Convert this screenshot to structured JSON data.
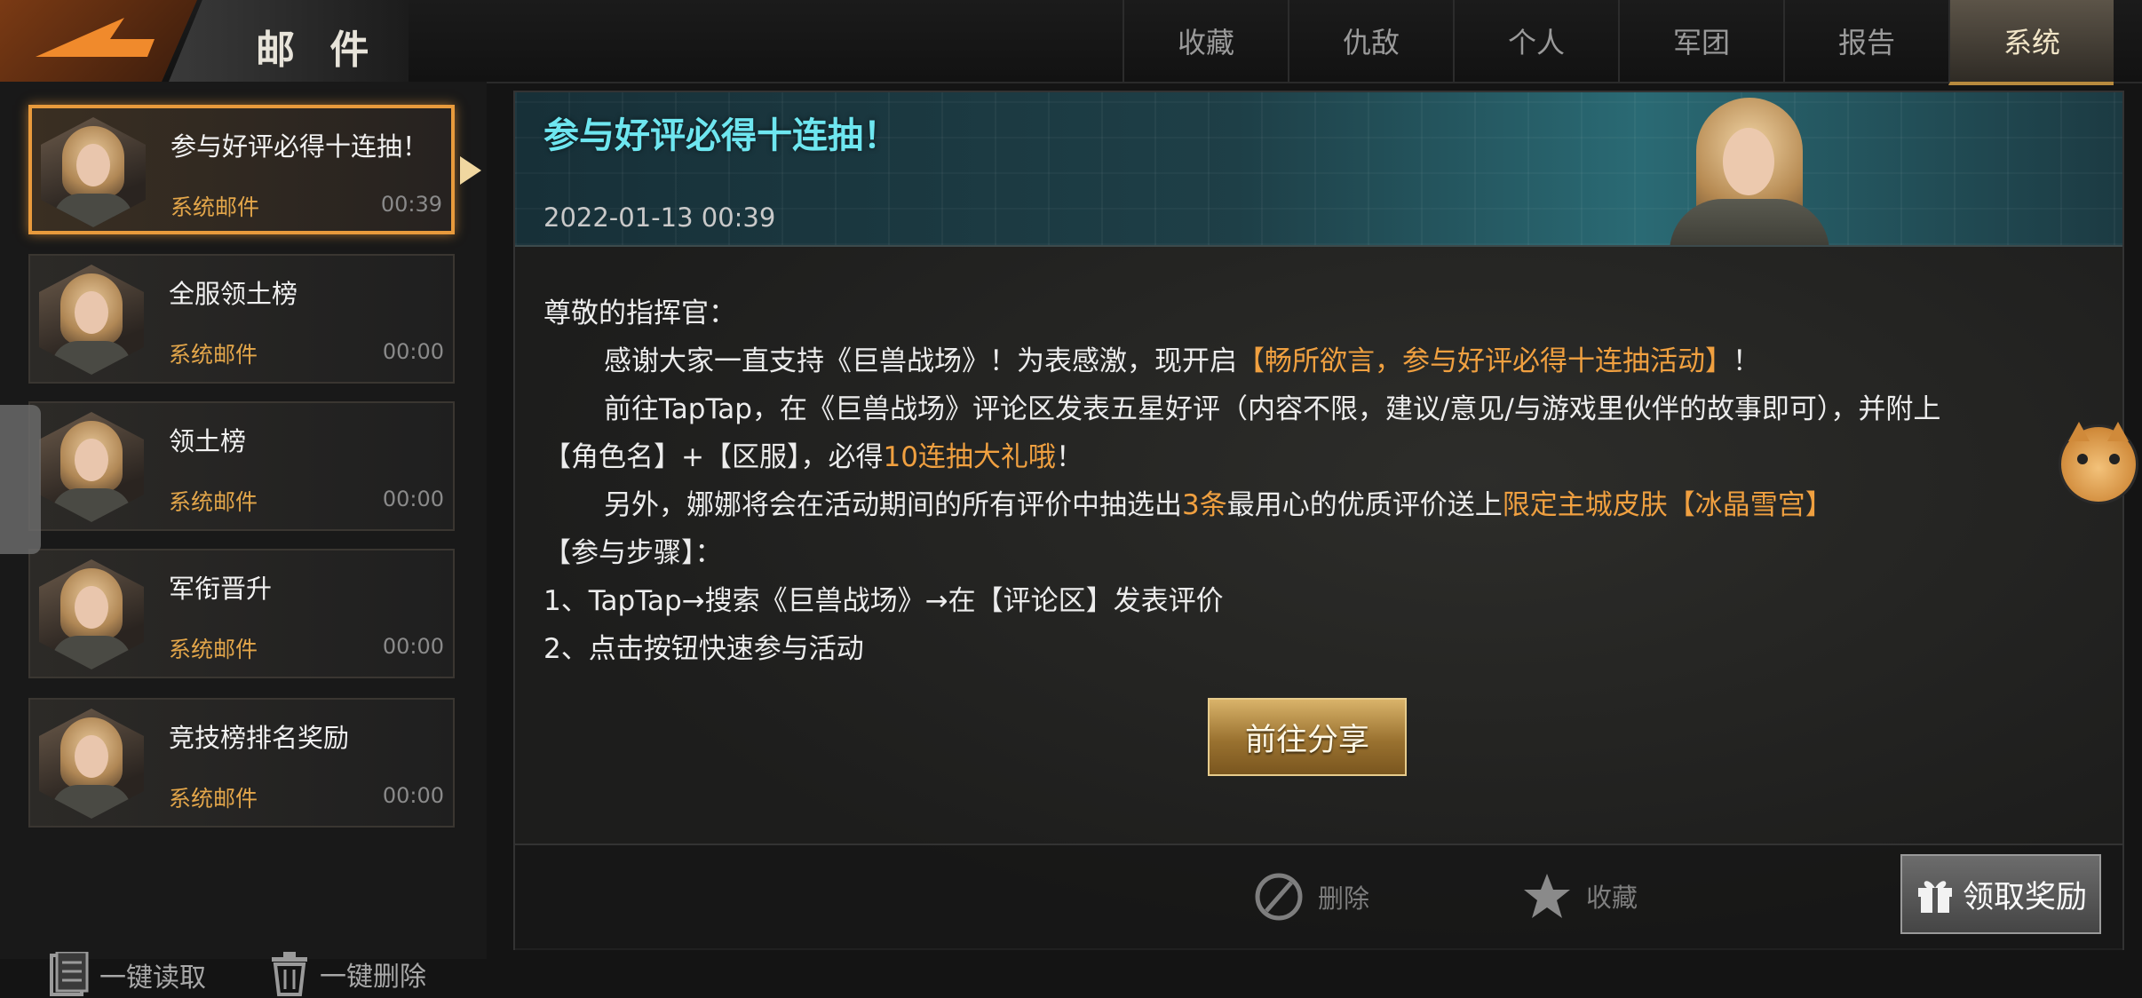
{
  "header": {
    "title": "邮 件",
    "tabs": [
      {
        "label": "收藏",
        "active": false
      },
      {
        "label": "仇敌",
        "active": false
      },
      {
        "label": "个人",
        "active": false
      },
      {
        "label": "军团",
        "active": false
      },
      {
        "label": "报告",
        "active": false
      },
      {
        "label": "系统",
        "active": true
      }
    ]
  },
  "mail_list": [
    {
      "title": "参与好评必得十连抽！",
      "sender": "系统邮件",
      "time": "00:39",
      "selected": true
    },
    {
      "title": "全服领土榜",
      "sender": "系统邮件",
      "time": "00:00",
      "selected": false
    },
    {
      "title": "领土榜",
      "sender": "系统邮件",
      "time": "00:00",
      "selected": false
    },
    {
      "title": "军衔晋升",
      "sender": "系统邮件",
      "time": "00:00",
      "selected": false
    },
    {
      "title": "竞技榜排名奖励",
      "sender": "系统邮件",
      "time": "00:00",
      "selected": false
    }
  ],
  "list_actions": {
    "read_all": "一键读取",
    "delete_all": "一键删除"
  },
  "mail": {
    "title": "参与好评必得十连抽！",
    "date": "2022-01-13  00:39",
    "greeting": "尊敬的指挥官：",
    "p1_a": "感谢大家一直支持《巨兽战场》！为表感激，现开启",
    "p1_hl": "【畅所欲言，参与好评必得十连抽活动】",
    "p1_b": "！",
    "p2_a": "前往TapTap，在《巨兽战场》评论区发表五星好评（内容不限，建议/意见/与游戏里伙伴的故事即可），并附上",
    "p2_b": "【角色名】+【区服】，必得",
    "p2_hl": "10连抽大礼哦",
    "p2_c": "！",
    "p3_a": "另外，娜娜将会在活动期间的所有评价中抽选出",
    "p3_hl1": "3条",
    "p3_b": "最用心的优质评价送上",
    "p3_hl2": "限定主城皮肤【冰晶雪宫】",
    "steps_title": "【参与步骤】：",
    "step1": "1、TapTap→搜索《巨兽战场》→在【评论区】发表评价",
    "step2": "2、点击按钮快速参与活动",
    "share_button": "前往分享"
  },
  "footer": {
    "delete": "删除",
    "favorite": "收藏",
    "claim": "领取奖励"
  },
  "colors": {
    "accent_orange": "#f0a040",
    "title_cyan": "#6ee6f0",
    "selected_border": "#e89a3c"
  }
}
